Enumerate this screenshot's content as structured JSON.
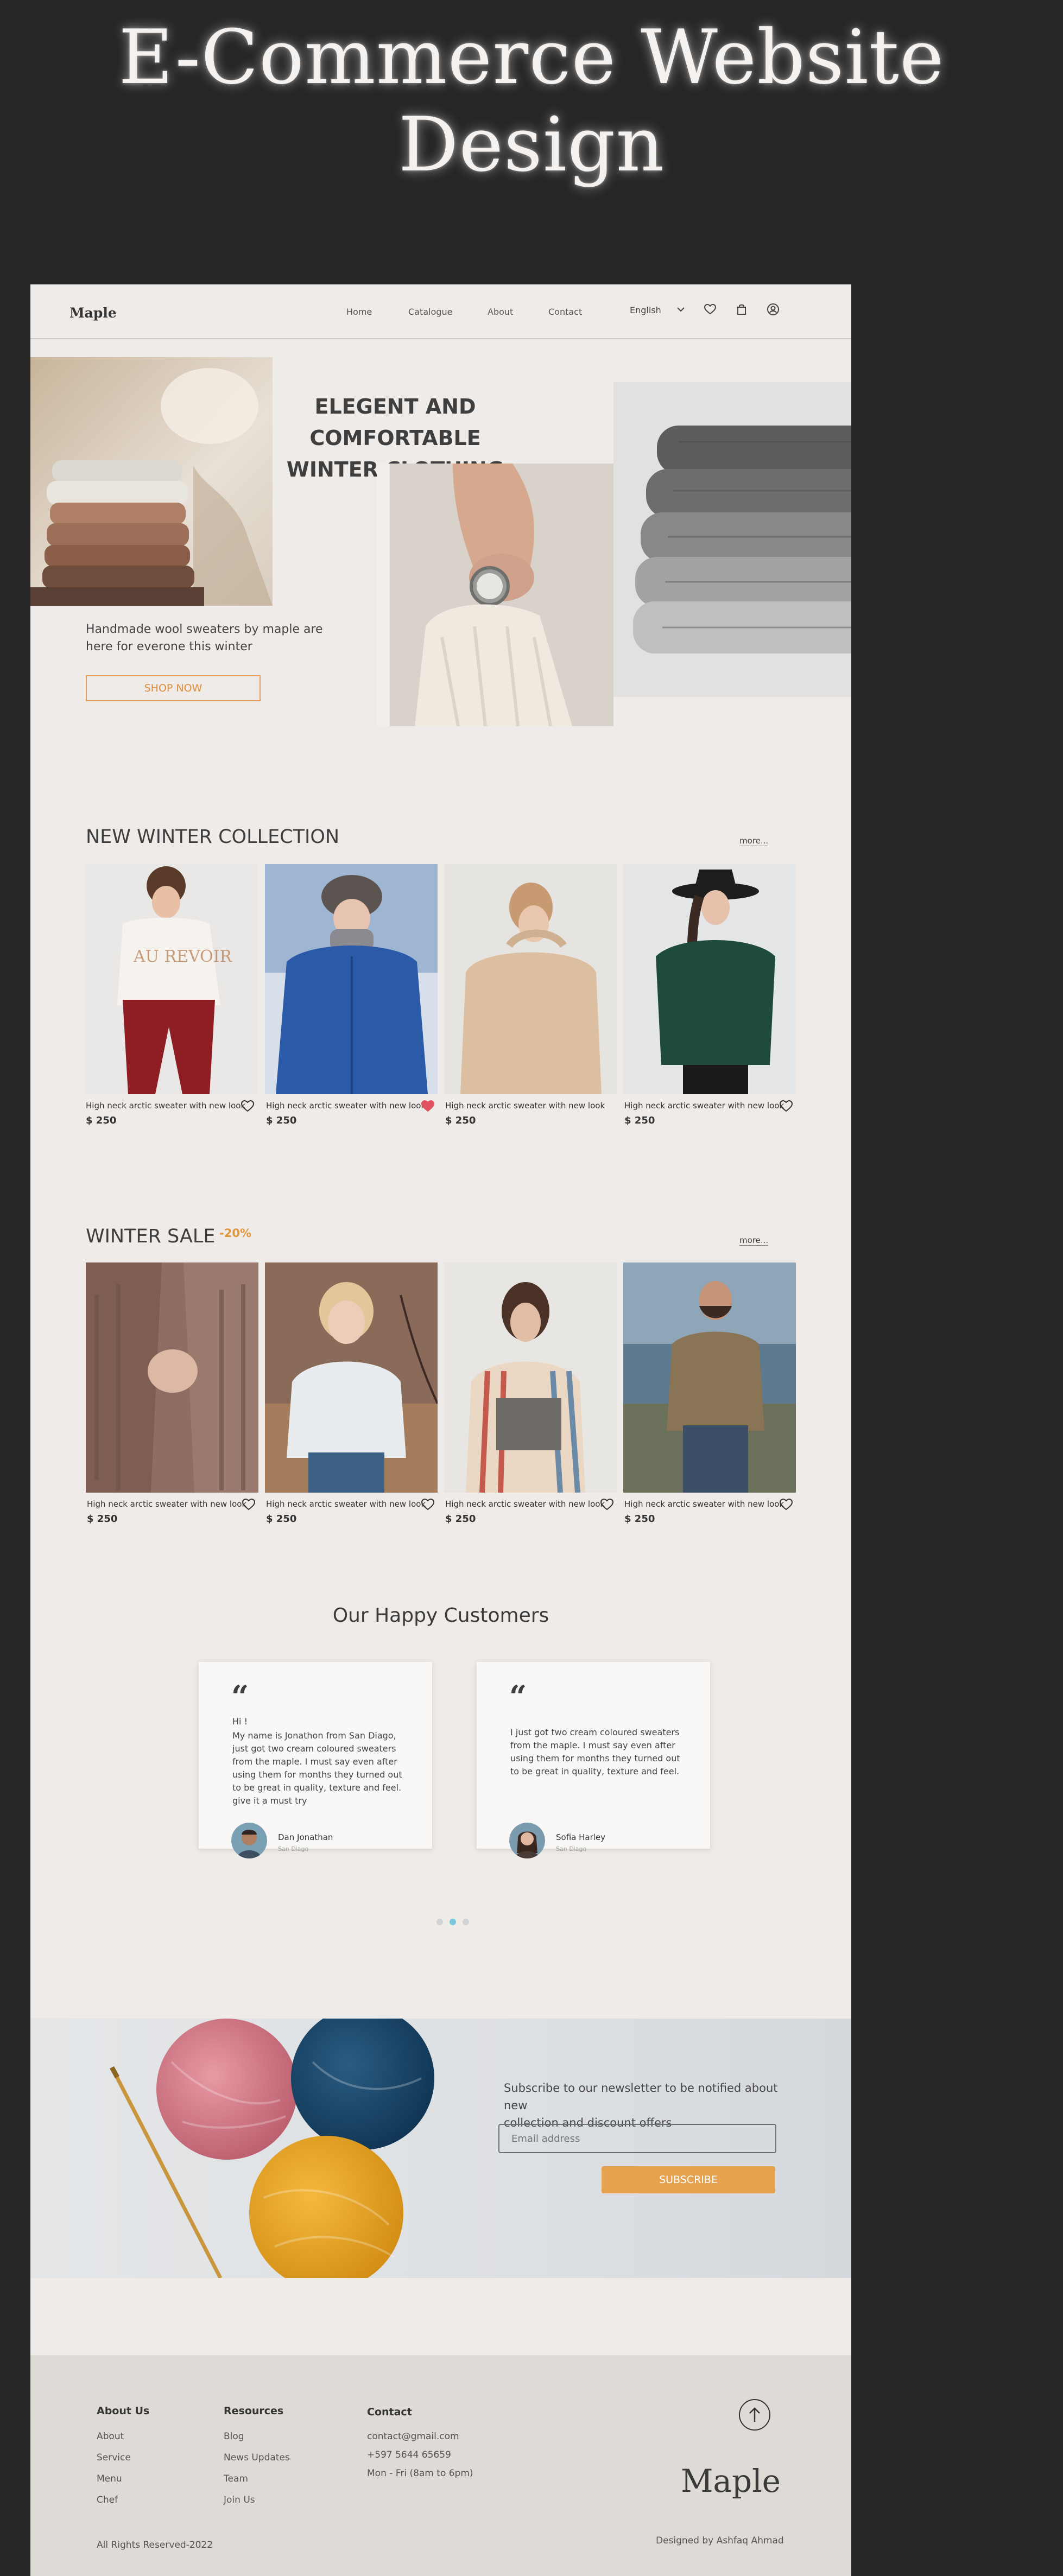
{
  "banner": {
    "title": "E-Commerce Website Design"
  },
  "header": {
    "logo": "Maple",
    "nav": [
      "Home",
      "Catalogue",
      "About",
      "Contact"
    ],
    "language": "English"
  },
  "hero": {
    "title_line1": "ELEGENT AND COMFORTABLE",
    "title_line2": "WINTER CLOTHING",
    "subtitle_line1": "Handmade wool sweaters by maple are",
    "subtitle_line2": "here for everone this winter",
    "button": "SHOP NOW"
  },
  "winter_collection": {
    "title": "NEW WINTER COLLECTION",
    "more": "more...",
    "items": [
      {
        "name": "High neck arctic sweater with new look",
        "price": "$ 250",
        "liked": false
      },
      {
        "name": "High neck arctic sweater with new look",
        "price": "$ 250",
        "liked": true
      },
      {
        "name": "High neck arctic sweater with new look",
        "price": "$ 250",
        "liked": false
      },
      {
        "name": "High neck arctic sweater with new look",
        "price": "$ 250",
        "liked": false
      }
    ]
  },
  "winter_sale": {
    "title": "WINTER SALE",
    "discount": "-20%",
    "more": "more...",
    "items": [
      {
        "name": "High neck arctic sweater with new look",
        "price": "$ 250",
        "liked": false
      },
      {
        "name": "High neck arctic sweater with new look",
        "price": "$ 250",
        "liked": false
      },
      {
        "name": "High neck arctic sweater with new look",
        "price": "$ 250",
        "liked": false
      },
      {
        "name": "High neck arctic sweater with new look",
        "price": "$ 250",
        "liked": false
      }
    ]
  },
  "testimonials": {
    "title": "Our Happy Customers",
    "cards": [
      {
        "quote_mark": "“",
        "greeting": "Hi !",
        "lines": [
          "My name is Jonathon from San Diago,",
          "just got two cream coloured sweaters",
          "from the maple. I must  say even after",
          "using them for months they turned out",
          "to be great in quality, texture and feel.",
          "give it a must try"
        ],
        "name": "Dan Jonathan",
        "location": "San Diago"
      },
      {
        "quote_mark": "“",
        "lines": [
          "I just got two cream coloured sweaters",
          "from the maple. I must  say even after",
          "using them for months they turned out",
          "to be great in quality, texture and feel."
        ],
        "name": "Sofia Harley",
        "location": "San Diago"
      }
    ],
    "active_dot": 1
  },
  "newsletter": {
    "text_line1": "Subscribe to our newsletter to be notified about new",
    "text_line2": "collection and discount offers",
    "email_placeholder": "Email address",
    "button": "SUBSCRIBE"
  },
  "footer": {
    "about": {
      "heading": "About Us",
      "links": [
        "About",
        "Service",
        "Menu",
        "Chef"
      ]
    },
    "resources": {
      "heading": "Resources",
      "links": [
        "Blog",
        "News Updates",
        "Team",
        "Join Us"
      ]
    },
    "contact": {
      "heading": "Contact",
      "lines": [
        "contact@gmail.com",
        "+597 5644 65659",
        "Mon - Fri  (8am to 6pm)"
      ]
    },
    "logo": "Maple",
    "copyright": "All Rights Reserved-2022",
    "designer": "Designed by Ashfaq Ahmad"
  },
  "colors": {
    "accent": "#e6a24f",
    "page_bg": "#efebe8",
    "outer_bg": "#262626",
    "heart_liked": "#e0525f"
  }
}
